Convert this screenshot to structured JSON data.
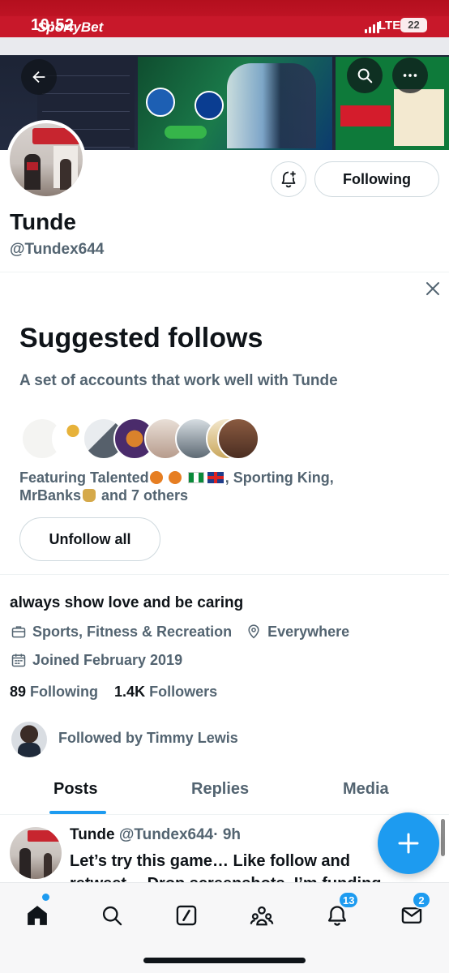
{
  "status_bar": {
    "time": "10:52",
    "network": "LTE",
    "battery": "22"
  },
  "banner": {
    "brand": "SportyBet"
  },
  "profile": {
    "name": "Tunde",
    "handle": "@Tundex644",
    "following_button": "Following",
    "bio": "always show love and be caring",
    "category": "Sports, Fitness & Recreation",
    "location": "Everywhere",
    "joined": "Joined February 2019",
    "following_count": "89",
    "following_label": "Following",
    "followers_count": "1.4K",
    "followers_label": "Followers",
    "followed_by": "Followed by Timmy Lewis"
  },
  "suggested": {
    "title": "Suggested follows",
    "subtitle": "A set of accounts that work well with Tunde",
    "featuring_prefix": "Featuring Talented",
    "featuring_mid": ", Sporting King,",
    "featuring_line2_a": "MrBanks",
    "featuring_line2_b": "and 7 others",
    "unfollow_all": "Unfollow all"
  },
  "tabs": [
    {
      "label": "Posts",
      "active": true
    },
    {
      "label": "Replies",
      "active": false
    },
    {
      "label": "Media",
      "active": false
    }
  ],
  "post": {
    "author": "Tunde",
    "handle": "@Tundex644",
    "time": "· 9h",
    "text": "Let’s try this game… Like follow and retweet… Drop screenshots. I’m funding"
  },
  "bottom_nav": {
    "items": [
      "home-icon",
      "search-icon",
      "grok-icon",
      "communities-icon",
      "notifications-icon",
      "messages-icon"
    ],
    "notifications_badge": "13",
    "messages_badge": "2"
  },
  "colors": {
    "accent": "#1d9bf0",
    "text": "#0f1419",
    "secondary": "#536471"
  }
}
